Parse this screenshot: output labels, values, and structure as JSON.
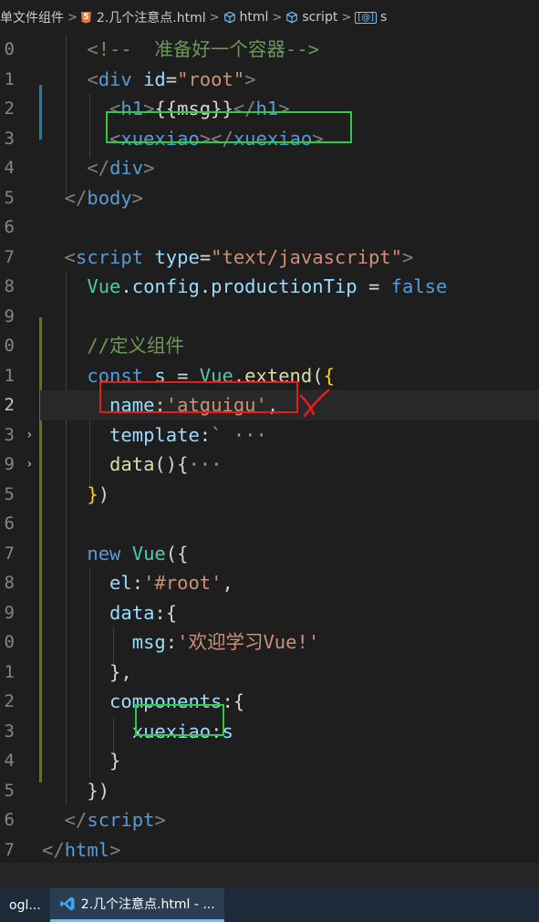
{
  "breadcrumb": {
    "items": [
      {
        "label": "单文件组件",
        "icon": ""
      },
      {
        "label": "2.几个注意点.html",
        "icon": "html5-icon"
      },
      {
        "label": "html",
        "icon": "cube-icon"
      },
      {
        "label": "script",
        "icon": "cube-icon"
      },
      {
        "label": "s",
        "icon": "variable-icon"
      }
    ],
    "separator": ">",
    "html5_badge": "5",
    "var_badge": "[@]"
  },
  "editor": {
    "lines": [
      {
        "n": "0",
        "tokens": [
          [
            "bracket",
            "    <"
          ],
          [
            "comment",
            "!--  准备好一个容器-->"
          ]
        ]
      },
      {
        "n": "1",
        "tokens": [
          [
            "bracket",
            "    <"
          ],
          [
            "tag",
            "div "
          ],
          [
            "attr",
            "id"
          ],
          [
            "plain",
            "="
          ],
          [
            "str",
            "\"root\""
          ],
          [
            "bracket",
            ">"
          ]
        ]
      },
      {
        "n": "2",
        "tokens": [
          [
            "bracket",
            "      <"
          ],
          [
            "tag",
            "h1"
          ],
          [
            "bracket",
            ">"
          ],
          [
            "plain",
            "{{msg}}"
          ],
          [
            "bracket",
            "</"
          ],
          [
            "tag",
            "h1"
          ],
          [
            "bracket",
            ">"
          ]
        ]
      },
      {
        "n": "3",
        "tokens": [
          [
            "bracket",
            "      <"
          ],
          [
            "tag",
            "xuexiao"
          ],
          [
            "bracket",
            "></"
          ],
          [
            "tag",
            "xuexiao"
          ],
          [
            "bracket",
            ">"
          ]
        ]
      },
      {
        "n": "4",
        "tokens": [
          [
            "bracket",
            "    </"
          ],
          [
            "tag",
            "div"
          ],
          [
            "bracket",
            ">"
          ]
        ]
      },
      {
        "n": "5",
        "tokens": [
          [
            "bracket",
            "  </"
          ],
          [
            "tag",
            "body"
          ],
          [
            "bracket",
            ">"
          ]
        ]
      },
      {
        "n": "6",
        "tokens": []
      },
      {
        "n": "7",
        "tokens": [
          [
            "bracket",
            "  <"
          ],
          [
            "tag",
            "script "
          ],
          [
            "attr",
            "type"
          ],
          [
            "plain",
            "="
          ],
          [
            "str",
            "\"text/javascript\""
          ],
          [
            "bracket",
            ">"
          ]
        ]
      },
      {
        "n": "8",
        "tokens": [
          [
            "cls",
            "    Vue"
          ],
          [
            "plain",
            "."
          ],
          [
            "prop",
            "config"
          ],
          [
            "plain",
            "."
          ],
          [
            "prop",
            "productionTip"
          ],
          [
            "plain",
            " = "
          ],
          [
            "kw",
            "false"
          ]
        ]
      },
      {
        "n": "9",
        "tokens": []
      },
      {
        "n": "0",
        "tokens": [
          [
            "comment",
            "    //定义组件"
          ]
        ]
      },
      {
        "n": "1",
        "tokens": [
          [
            "kw",
            "    const "
          ],
          [
            "prop",
            "s"
          ],
          [
            "plain",
            " = "
          ],
          [
            "cls",
            "Vue"
          ],
          [
            "plain",
            "."
          ],
          [
            "fn",
            "extend"
          ],
          [
            "plain",
            "("
          ],
          [
            "yellow",
            "{"
          ]
        ]
      },
      {
        "n": "2",
        "tokens": [
          [
            "prop",
            "      name"
          ],
          [
            "plain",
            ":"
          ],
          [
            "str",
            "'atguigu'"
          ],
          [
            "plain",
            ","
          ]
        ]
      },
      {
        "n": "3",
        "tokens": [
          [
            "prop",
            "      template"
          ],
          [
            "plain",
            ":"
          ],
          [
            "str",
            "`"
          ],
          [
            "ellipsis",
            " ···"
          ]
        ]
      },
      {
        "n": "9",
        "tokens": [
          [
            "fn",
            "      data"
          ],
          [
            "plain",
            "(){"
          ],
          [
            "ellipsis",
            "···"
          ]
        ]
      },
      {
        "n": "5",
        "tokens": [
          [
            "yellow",
            "    }"
          ],
          [
            "plain",
            ")"
          ]
        ]
      },
      {
        "n": "6",
        "tokens": []
      },
      {
        "n": "7",
        "tokens": [
          [
            "kw",
            "    new "
          ],
          [
            "cls",
            "Vue"
          ],
          [
            "plain",
            "({"
          ]
        ]
      },
      {
        "n": "8",
        "tokens": [
          [
            "prop",
            "      el"
          ],
          [
            "plain",
            ":"
          ],
          [
            "str",
            "'#root'"
          ],
          [
            "plain",
            ","
          ]
        ]
      },
      {
        "n": "9",
        "tokens": [
          [
            "prop",
            "      data"
          ],
          [
            "plain",
            ":{"
          ]
        ]
      },
      {
        "n": "0",
        "tokens": [
          [
            "prop",
            "        msg"
          ],
          [
            "plain",
            ":"
          ],
          [
            "str",
            "'欢迎学习Vue!'"
          ]
        ]
      },
      {
        "n": "1",
        "tokens": [
          [
            "plain",
            "      },"
          ]
        ]
      },
      {
        "n": "2",
        "tokens": [
          [
            "prop",
            "      components"
          ],
          [
            "plain",
            ":{"
          ]
        ]
      },
      {
        "n": "3",
        "tokens": [
          [
            "prop",
            "        xuexiao"
          ],
          [
            "plain",
            ":"
          ],
          [
            "prop",
            "s"
          ]
        ]
      },
      {
        "n": "4",
        "tokens": [
          [
            "plain",
            "      }"
          ]
        ]
      },
      {
        "n": "5",
        "tokens": [
          [
            "plain",
            "    })"
          ]
        ]
      },
      {
        "n": "6",
        "tokens": [
          [
            "bracket",
            "  </"
          ],
          [
            "tag",
            "script"
          ],
          [
            "bracket",
            ">"
          ]
        ]
      },
      {
        "n": "7",
        "tokens": [
          [
            "bracket",
            "</"
          ],
          [
            "tag",
            "html"
          ],
          [
            "bracket",
            ">"
          ]
        ]
      }
    ],
    "folded_lines": [
      13,
      14
    ],
    "active_line": 12
  },
  "taskbar": {
    "items": [
      {
        "label": "ogl...",
        "active": false,
        "icon": ""
      },
      {
        "label": "2.几个注意点.html - ...",
        "active": true,
        "icon": "vscode-icon"
      }
    ]
  },
  "colors": {
    "highlight_green": "#2ecc40",
    "highlight_red": "#e81c1c",
    "editor_bg": "#1e1e1e"
  }
}
